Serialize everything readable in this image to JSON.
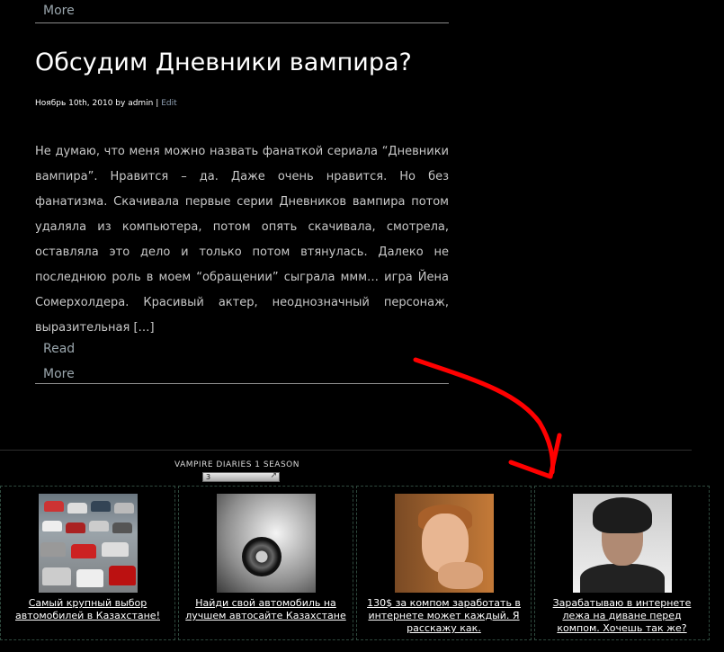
{
  "post_top": {
    "more_label": "More"
  },
  "post": {
    "title": "Обсудим Дневники вампира?",
    "meta_date_author": "Ноябрь 10th, 2010 by admin",
    "meta_separator": "|",
    "edit_label": "Edit",
    "excerpt": "Не думаю, что меня можно назвать фанаткой сериала “Дневники вампира”. Нравится – да. Даже очень нравится. Но без фанатизма. Скачивала первые серии Дневников вампира потом удаляла из компьютера, потом опять скачивала, смотрела, оставляла это дело и только потом втянулась. Далеко не последнюю роль в моем “обращении” сыграла ммм… игра Йена Сомерхолдера. Красивый актер, неоднозначный персонаж, выразительная […]",
    "read_label": "Read",
    "more_label": "More"
  },
  "widget": {
    "title": "VAMPIRE DIARIES 1 SEASON",
    "select_value": "3"
  },
  "ads": [
    {
      "image": "cars-lot",
      "text": "Самый крупный выбор автомобилей в Казахстане!"
    },
    {
      "image": "supercar",
      "text": "Найди свой автомобиль на лучшем автосайте Казахстане"
    },
    {
      "image": "boy-portrait",
      "text": "130$ за компом заработать в интернете может каждый. Я расскажу как."
    },
    {
      "image": "man-portrait",
      "text": "Зарабатываю в интернете лежа на диване перед компом. Хочешь так же?"
    }
  ],
  "colors": {
    "background": "#000000",
    "link": "#9aa6ad",
    "annotation_arrow": "#ff0000",
    "ad_border": "#2f4a3e"
  }
}
